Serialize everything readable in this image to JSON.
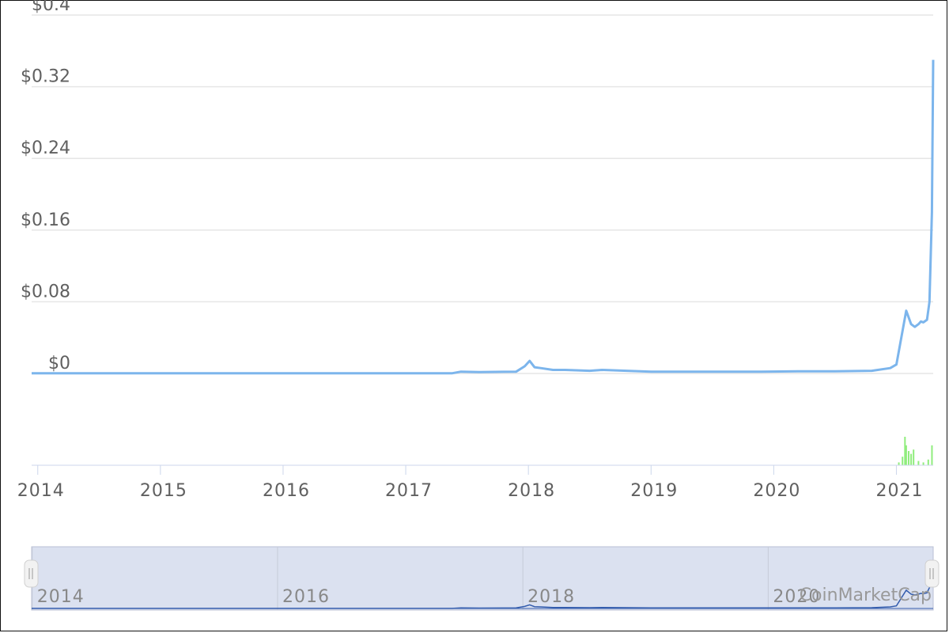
{
  "chart_data": {
    "type": "line",
    "title": "",
    "xlabel": "",
    "ylabel": "",
    "x_range": [
      2013.95,
      2021.3
    ],
    "ylim": [
      0,
      0.4
    ],
    "y_ticks": [
      {
        "value": 0,
        "label": "$0"
      },
      {
        "value": 0.08,
        "label": "$0.08"
      },
      {
        "value": 0.16,
        "label": "$0.16"
      },
      {
        "value": 0.24,
        "label": "$0.24"
      },
      {
        "value": 0.32,
        "label": "$0.32"
      },
      {
        "value": 0.4,
        "label": "$0.4"
      }
    ],
    "x_ticks": [
      {
        "value": 2014,
        "label": "2014"
      },
      {
        "value": 2015,
        "label": "2015"
      },
      {
        "value": 2016,
        "label": "2016"
      },
      {
        "value": 2017,
        "label": "2017"
      },
      {
        "value": 2018,
        "label": "2018"
      },
      {
        "value": 2019,
        "label": "2019"
      },
      {
        "value": 2020,
        "label": "2020"
      },
      {
        "value": 2021,
        "label": "2021"
      }
    ],
    "grid": true,
    "series": [
      {
        "color": "#7cb5ec",
        "x": [
          2013.95,
          2014.5,
          2015.0,
          2015.5,
          2016.0,
          2016.5,
          2017.0,
          2017.38,
          2017.45,
          2017.6,
          2017.9,
          2017.97,
          2018.01,
          2018.05,
          2018.1,
          2018.2,
          2018.3,
          2018.5,
          2018.6,
          2018.8,
          2019.0,
          2019.3,
          2019.6,
          2019.9,
          2020.2,
          2020.5,
          2020.8,
          2020.95,
          2021.0,
          2021.08,
          2021.12,
          2021.15,
          2021.18,
          2021.2,
          2021.22,
          2021.25,
          2021.27,
          2021.29,
          2021.3
        ],
        "y": [
          0.0003,
          0.0002,
          0.0002,
          0.0002,
          0.0002,
          0.0002,
          0.0002,
          0.0003,
          0.002,
          0.0015,
          0.002,
          0.008,
          0.014,
          0.007,
          0.006,
          0.004,
          0.004,
          0.003,
          0.004,
          0.003,
          0.002,
          0.002,
          0.002,
          0.002,
          0.0025,
          0.0025,
          0.003,
          0.006,
          0.01,
          0.07,
          0.055,
          0.052,
          0.055,
          0.058,
          0.057,
          0.06,
          0.08,
          0.18,
          0.35
        ]
      }
    ],
    "volume": {
      "color": "#90ed7d",
      "x": [
        2021.02,
        2021.05,
        2021.07,
        2021.08,
        2021.1,
        2021.12,
        2021.14,
        2021.18,
        2021.22,
        2021.26,
        2021.29
      ],
      "y": [
        0.1,
        0.3,
        1.0,
        0.7,
        0.5,
        0.4,
        0.55,
        0.15,
        0.1,
        0.2,
        0.7
      ]
    },
    "navigator": {
      "labels": [
        {
          "value": 2014,
          "label": "2014"
        },
        {
          "value": 2016,
          "label": "2016"
        },
        {
          "value": 2018,
          "label": "2018"
        },
        {
          "value": 2020,
          "label": "2020"
        }
      ]
    },
    "credit": "CoinMarketCap"
  }
}
